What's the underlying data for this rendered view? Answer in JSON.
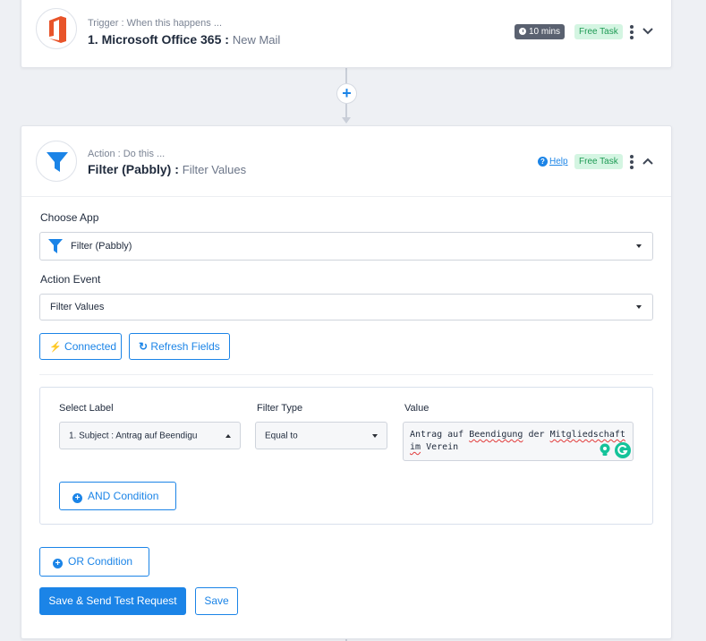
{
  "trigger": {
    "subtitle": "Trigger : When this happens ...",
    "title_app": "1. Microsoft Office 365 :",
    "title_event": "New Mail",
    "time_badge": "10 mins",
    "free_task": "Free Task",
    "icon": "office365-icon"
  },
  "connector": {
    "add_label": "+"
  },
  "action": {
    "subtitle": "Action : Do this ...",
    "title_app": "Filter (Pabbly) :",
    "title_event": "Filter Values",
    "help": "Help",
    "free_task": "Free Task",
    "icon": "filter-funnel-icon",
    "choose_app_label": "Choose App",
    "choose_app_value": "Filter (Pabbly)",
    "action_event_label": "Action Event",
    "action_event_value": "Filter Values",
    "connected_label": "Connected",
    "refresh_label": "Refresh Fields",
    "filter": {
      "headers": {
        "select_label": "Select Label",
        "filter_type": "Filter Type",
        "value": "Value"
      },
      "select_label_value": "1. Subject : Antrag auf Beendigu",
      "filter_type_value": "Equal to",
      "value_line1_a": "Antrag auf",
      "value_line1_b": "Beendigung",
      "value_line1_c": "der",
      "value_line1_d": "Mitgliedschaft",
      "value_line2_a": "im",
      "value_line2_b": "Verein",
      "and_condition": "AND Condition"
    },
    "or_condition": "OR Condition",
    "save_send": "Save & Send Test Request",
    "save": "Save"
  },
  "colors": {
    "accent": "#1b84e7",
    "free_task_bg": "#d4f5e2",
    "free_task_text": "#1e9a54",
    "office_orange": "#e8542a",
    "grammarly": "#15c39a"
  }
}
